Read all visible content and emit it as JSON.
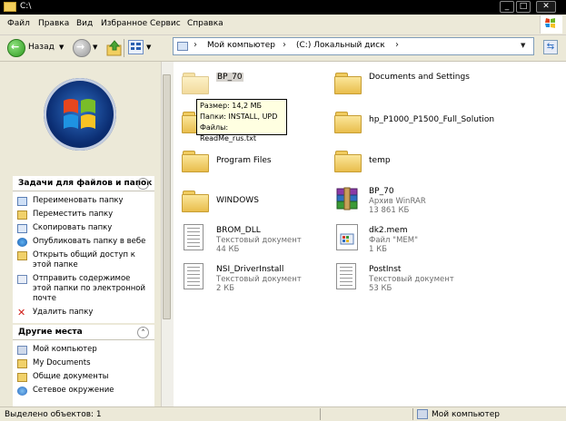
{
  "window": {
    "title": "C:\\"
  },
  "menu": [
    "Файл",
    "Правка",
    "Вид",
    "Избранное",
    "Сервис",
    "Справка"
  ],
  "toolbar": {
    "back_label": "Назад"
  },
  "address": {
    "path_parts": [
      "Мой компьютер",
      "(C:) Локальный диск"
    ]
  },
  "tasks_panel": {
    "title": "Задачи для файлов и папок",
    "items": [
      {
        "label": "Переименовать папку",
        "icon": "rename-icon"
      },
      {
        "label": "Переместить папку",
        "icon": "move-icon"
      },
      {
        "label": "Скопировать папку",
        "icon": "copy-icon"
      },
      {
        "label": "Опубликовать папку в вебе",
        "icon": "web-publish-icon"
      },
      {
        "label": "Открыть общий доступ к этой папке",
        "icon": "share-icon"
      },
      {
        "label": "Отправить содержимое этой папки по электронной почте",
        "icon": "email-icon"
      },
      {
        "label": "Удалить папку",
        "icon": "delete-icon"
      }
    ]
  },
  "places_panel": {
    "title": "Другие места",
    "items": [
      {
        "label": "Мой компьютер",
        "icon": "computer-icon"
      },
      {
        "label": "My Documents",
        "icon": "folder-icon"
      },
      {
        "label": "Общие документы",
        "icon": "folder-icon"
      },
      {
        "label": "Сетевое окружение",
        "icon": "network-icon"
      }
    ]
  },
  "files": [
    {
      "name": "BP_70",
      "type": "folder",
      "selected": true
    },
    {
      "name": "Documents and Settings",
      "type": "folder"
    },
    {
      "name": "",
      "type": "folder"
    },
    {
      "name": "hp_P1000_P1500_Full_Solution",
      "type": "folder"
    },
    {
      "name": "Program Files",
      "type": "folder"
    },
    {
      "name": "temp",
      "type": "folder"
    },
    {
      "name": "WINDOWS",
      "type": "folder"
    },
    {
      "name": "BP_70",
      "type": "rar",
      "sub1": "Архив WinRAR",
      "sub2": "13 861 КБ"
    },
    {
      "name": "BROM_DLL",
      "type": "doc",
      "sub1": "Текстовый документ",
      "sub2": "44 КБ"
    },
    {
      "name": "dk2.mem",
      "type": "mem",
      "sub1": "Файл \"MEM\"",
      "sub2": "1 КБ"
    },
    {
      "name": "NSI_DriverInstall",
      "type": "doc",
      "sub1": "Текстовый документ",
      "sub2": "2 КБ"
    },
    {
      "name": "PostInst",
      "type": "doc",
      "sub1": "Текстовый документ",
      "sub2": "53 КБ"
    }
  ],
  "tooltip": {
    "lines": [
      "Размер: 14,2 МБ",
      "Папки: INSTALL, UPD",
      "Файлы: ReadMe_rus.txt"
    ]
  },
  "status": {
    "left": "Выделено объектов: 1",
    "right": "Мой компьютер"
  }
}
